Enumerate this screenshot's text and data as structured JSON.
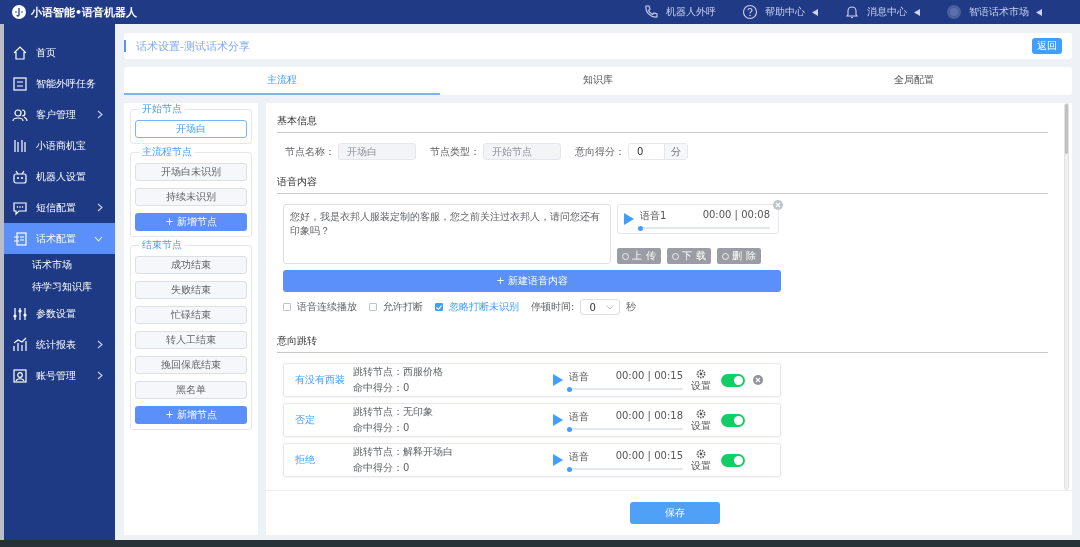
{
  "app": {
    "title": "小语智能•语音机器人"
  },
  "header_links": [
    {
      "kind": "phone",
      "label": "机器人外呼",
      "caret": false
    },
    {
      "kind": "help",
      "label": "帮助中心",
      "caret": true
    },
    {
      "kind": "bell",
      "label": "消息中心",
      "caret": true
    },
    {
      "kind": "avatar",
      "label": "智语话术市场",
      "caret": true
    }
  ],
  "sidebar": {
    "items": [
      {
        "kind": "link",
        "label": "首页",
        "selected": false
      },
      {
        "kind": "link",
        "label": "智能外呼任务",
        "selected": false
      },
      {
        "kind": "menu",
        "label": "客户管理",
        "expanded": false,
        "selected": false
      },
      {
        "kind": "link",
        "label": "小语商机宝",
        "selected": false
      },
      {
        "kind": "link",
        "label": "机器人设置",
        "selected": false
      },
      {
        "kind": "menu",
        "label": "短信配置",
        "expanded": false,
        "selected": false
      },
      {
        "kind": "menu",
        "label": "话术配置",
        "expanded": true,
        "selected": true,
        "children": [
          {
            "label": "话术市场",
            "selected": false
          },
          {
            "label": "待学习知识库",
            "selected": false
          }
        ]
      },
      {
        "kind": "link",
        "label": "参数设置",
        "selected": false
      },
      {
        "kind": "menu",
        "label": "统计报表",
        "expanded": false,
        "selected": false
      },
      {
        "kind": "menu",
        "label": "账号管理",
        "expanded": false,
        "selected": false
      }
    ]
  },
  "page_title": "话术设置-测试话术分享",
  "back_button": "返回",
  "tabs": [
    {
      "label": "主流程",
      "selected": true
    },
    {
      "label": "知识库",
      "selected": false
    },
    {
      "label": "全局配置",
      "selected": false
    }
  ],
  "node_groups": [
    {
      "title": "开始节点",
      "nodes": [
        {
          "label": "开场白",
          "selected": true
        }
      ]
    },
    {
      "title": "主流程节点",
      "nodes": [
        {
          "label": "开场白未识别",
          "selected": false
        },
        {
          "label": "持续未识别",
          "selected": false
        }
      ],
      "add_button": "+ 新增节点"
    },
    {
      "title": "结束节点",
      "nodes": [
        {
          "label": "成功结束",
          "selected": false
        },
        {
          "label": "失败结束",
          "selected": false
        },
        {
          "label": "忙碌结束",
          "selected": false
        },
        {
          "label": "转人工结束",
          "selected": false
        },
        {
          "label": "挽回保底结束",
          "selected": false
        },
        {
          "label": "黑名单",
          "selected": false
        }
      ],
      "add_button": "+ 新增节点"
    }
  ],
  "basic_info": {
    "heading": "基本信息",
    "fields": [
      {
        "label": "节点名称：",
        "value": "开场白",
        "disabled": true
      },
      {
        "label": "节点类型：",
        "value": "开始节点",
        "disabled": true
      },
      {
        "label": "意向得分：",
        "value": "0",
        "disabled": false,
        "suffix": "分"
      }
    ]
  },
  "voice": {
    "heading": "语音内容",
    "text": "您好，我是衣邦人服装定制的客服，您之前关注过衣邦人，请问您还有印象吗？",
    "audio": {
      "name": "语音1",
      "time": "00:00 | 00:08",
      "level": 0
    },
    "buttons": [
      {
        "label": "上 传",
        "disabled": true
      },
      {
        "label": "下 载",
        "disabled": true
      },
      {
        "label": "删 除",
        "disabled": true
      }
    ],
    "add_button": "+ 新建语音内容",
    "options": [
      {
        "label": "语音连续播放",
        "checked": false
      },
      {
        "label": "允许打断",
        "checked": false
      },
      {
        "label": "忽略打断未识别",
        "checked": true
      }
    ],
    "pause": {
      "label": "停顿时间:",
      "value": "0",
      "unit": "秒"
    }
  },
  "intents": {
    "heading": "意向跳转",
    "rows": [
      {
        "name": "有没有西装",
        "jump": "跳转节点：西服价格",
        "score": "命中得分：0",
        "audio": "语音",
        "time": "00:00 | 00:15",
        "level": 0,
        "settings": "设置",
        "on": true,
        "removable": true
      },
      {
        "name": "否定",
        "jump": "跳转节点：无印象",
        "score": "命中得分：0",
        "audio": "语音",
        "time": "00:00 | 00:18",
        "level": 0,
        "settings": "设置",
        "on": true,
        "removable": false
      },
      {
        "name": "拒绝",
        "jump": "跳转节点：解释开场白",
        "score": "命中得分：0",
        "audio": "语音",
        "time": "00:00 | 00:15",
        "level": 0,
        "settings": "设置",
        "on": true,
        "removable": false
      }
    ]
  },
  "save_button": "保存"
}
